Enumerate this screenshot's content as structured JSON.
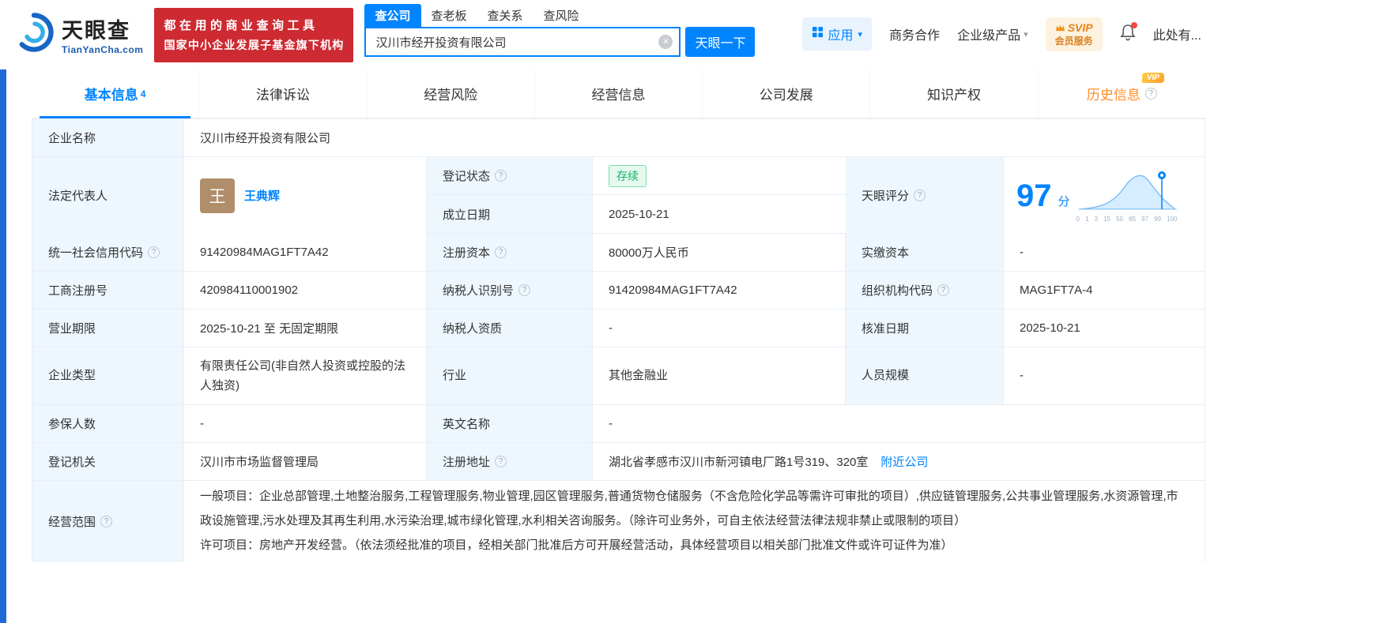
{
  "ui": {
    "qmark": "?",
    "caret": "▾",
    "close": "✕"
  },
  "header": {
    "logo_title": "天眼查",
    "logo_subtitle": "TianYanCha.com",
    "banner_line1": "都在用的商业查询工具",
    "banner_line2": "国家中小企业发展子基金旗下机构",
    "search_tabs": [
      {
        "label": "查公司"
      },
      {
        "label": "查老板"
      },
      {
        "label": "查关系"
      },
      {
        "label": "查风险"
      }
    ],
    "search_value": "汉川市经开投资有限公司",
    "search_button": "天眼一下",
    "apps_label": "应用",
    "link_cooperation": "商务合作",
    "link_enterprise": "企业级产品",
    "svip_line1": "SVIP",
    "svip_line2": "会员服务",
    "user_label": "此处有..."
  },
  "nav": {
    "tabs": [
      {
        "label": "基本信息",
        "count": "4"
      },
      {
        "label": "法律诉讼"
      },
      {
        "label": "经营风险"
      },
      {
        "label": "经营信息"
      },
      {
        "label": "公司发展"
      },
      {
        "label": "知识产权"
      },
      {
        "label": "历史信息",
        "vip": "VIP"
      }
    ]
  },
  "info": {
    "rows": {
      "company_name": {
        "label": "企业名称",
        "value": "汉川市经开投资有限公司"
      },
      "legal_rep": {
        "label": "法定代表人",
        "avatar": "王",
        "name": "王典辉"
      },
      "reg_status": {
        "label": "登记状态",
        "value": "存续"
      },
      "establish_date": {
        "label": "成立日期",
        "value": "2025-10-21"
      },
      "score": {
        "label": "天眼评分",
        "value": "97",
        "unit": "分",
        "axis": [
          "0",
          "1",
          "3",
          "15",
          "50",
          "85",
          "97",
          "99",
          "100"
        ]
      },
      "credit_code": {
        "label": "统一社会信用代码",
        "value": "91420984MAG1FT7A42"
      },
      "reg_capital": {
        "label": "注册资本",
        "value": "80000万人民币"
      },
      "paid_capital": {
        "label": "实缴资本",
        "value": "-"
      },
      "reg_number": {
        "label": "工商注册号",
        "value": "420984110001902"
      },
      "taxpayer_id": {
        "label": "纳税人识别号",
        "value": "91420984MAG1FT7A42"
      },
      "org_code": {
        "label": "组织机构代码",
        "value": "MAG1FT7A-4"
      },
      "business_term": {
        "label": "营业期限",
        "value": "2025-10-21 至 无固定期限"
      },
      "taxpayer_quality": {
        "label": "纳税人资质",
        "value": "-"
      },
      "approval_date": {
        "label": "核准日期",
        "value": "2025-10-21"
      },
      "company_type": {
        "label": "企业类型",
        "value": "有限责任公司(非自然人投资或控股的法人独资)"
      },
      "industry": {
        "label": "行业",
        "value": "其他金融业"
      },
      "staff_size": {
        "label": "人员规模",
        "value": "-"
      },
      "insured_count": {
        "label": "参保人数",
        "value": "-"
      },
      "english_name": {
        "label": "英文名称",
        "value": "-"
      },
      "reg_authority": {
        "label": "登记机关",
        "value": "汉川市市场监督管理局"
      },
      "reg_address": {
        "label": "注册地址",
        "value": "湖北省孝感市汉川市新河镇电厂路1号319、320室",
        "link": "附近公司"
      },
      "business_scope": {
        "label": "经营范围",
        "value": "一般项目：企业总部管理,土地整治服务,工程管理服务,物业管理,园区管理服务,普通货物仓储服务（不含危险化学品等需许可审批的项目）,供应链管理服务,公共事业管理服务,水资源管理,市政设施管理,污水处理及其再生利用,水污染治理,城市绿化管理,水利相关咨询服务。（除许可业务外，可自主依法经营法律法规非禁止或限制的项目）\n许可项目：房地产开发经营。（依法须经批准的项目，经相关部门批准后方可开展经营活动，具体经营项目以相关部门批准文件或许可证件为准）"
      }
    }
  }
}
